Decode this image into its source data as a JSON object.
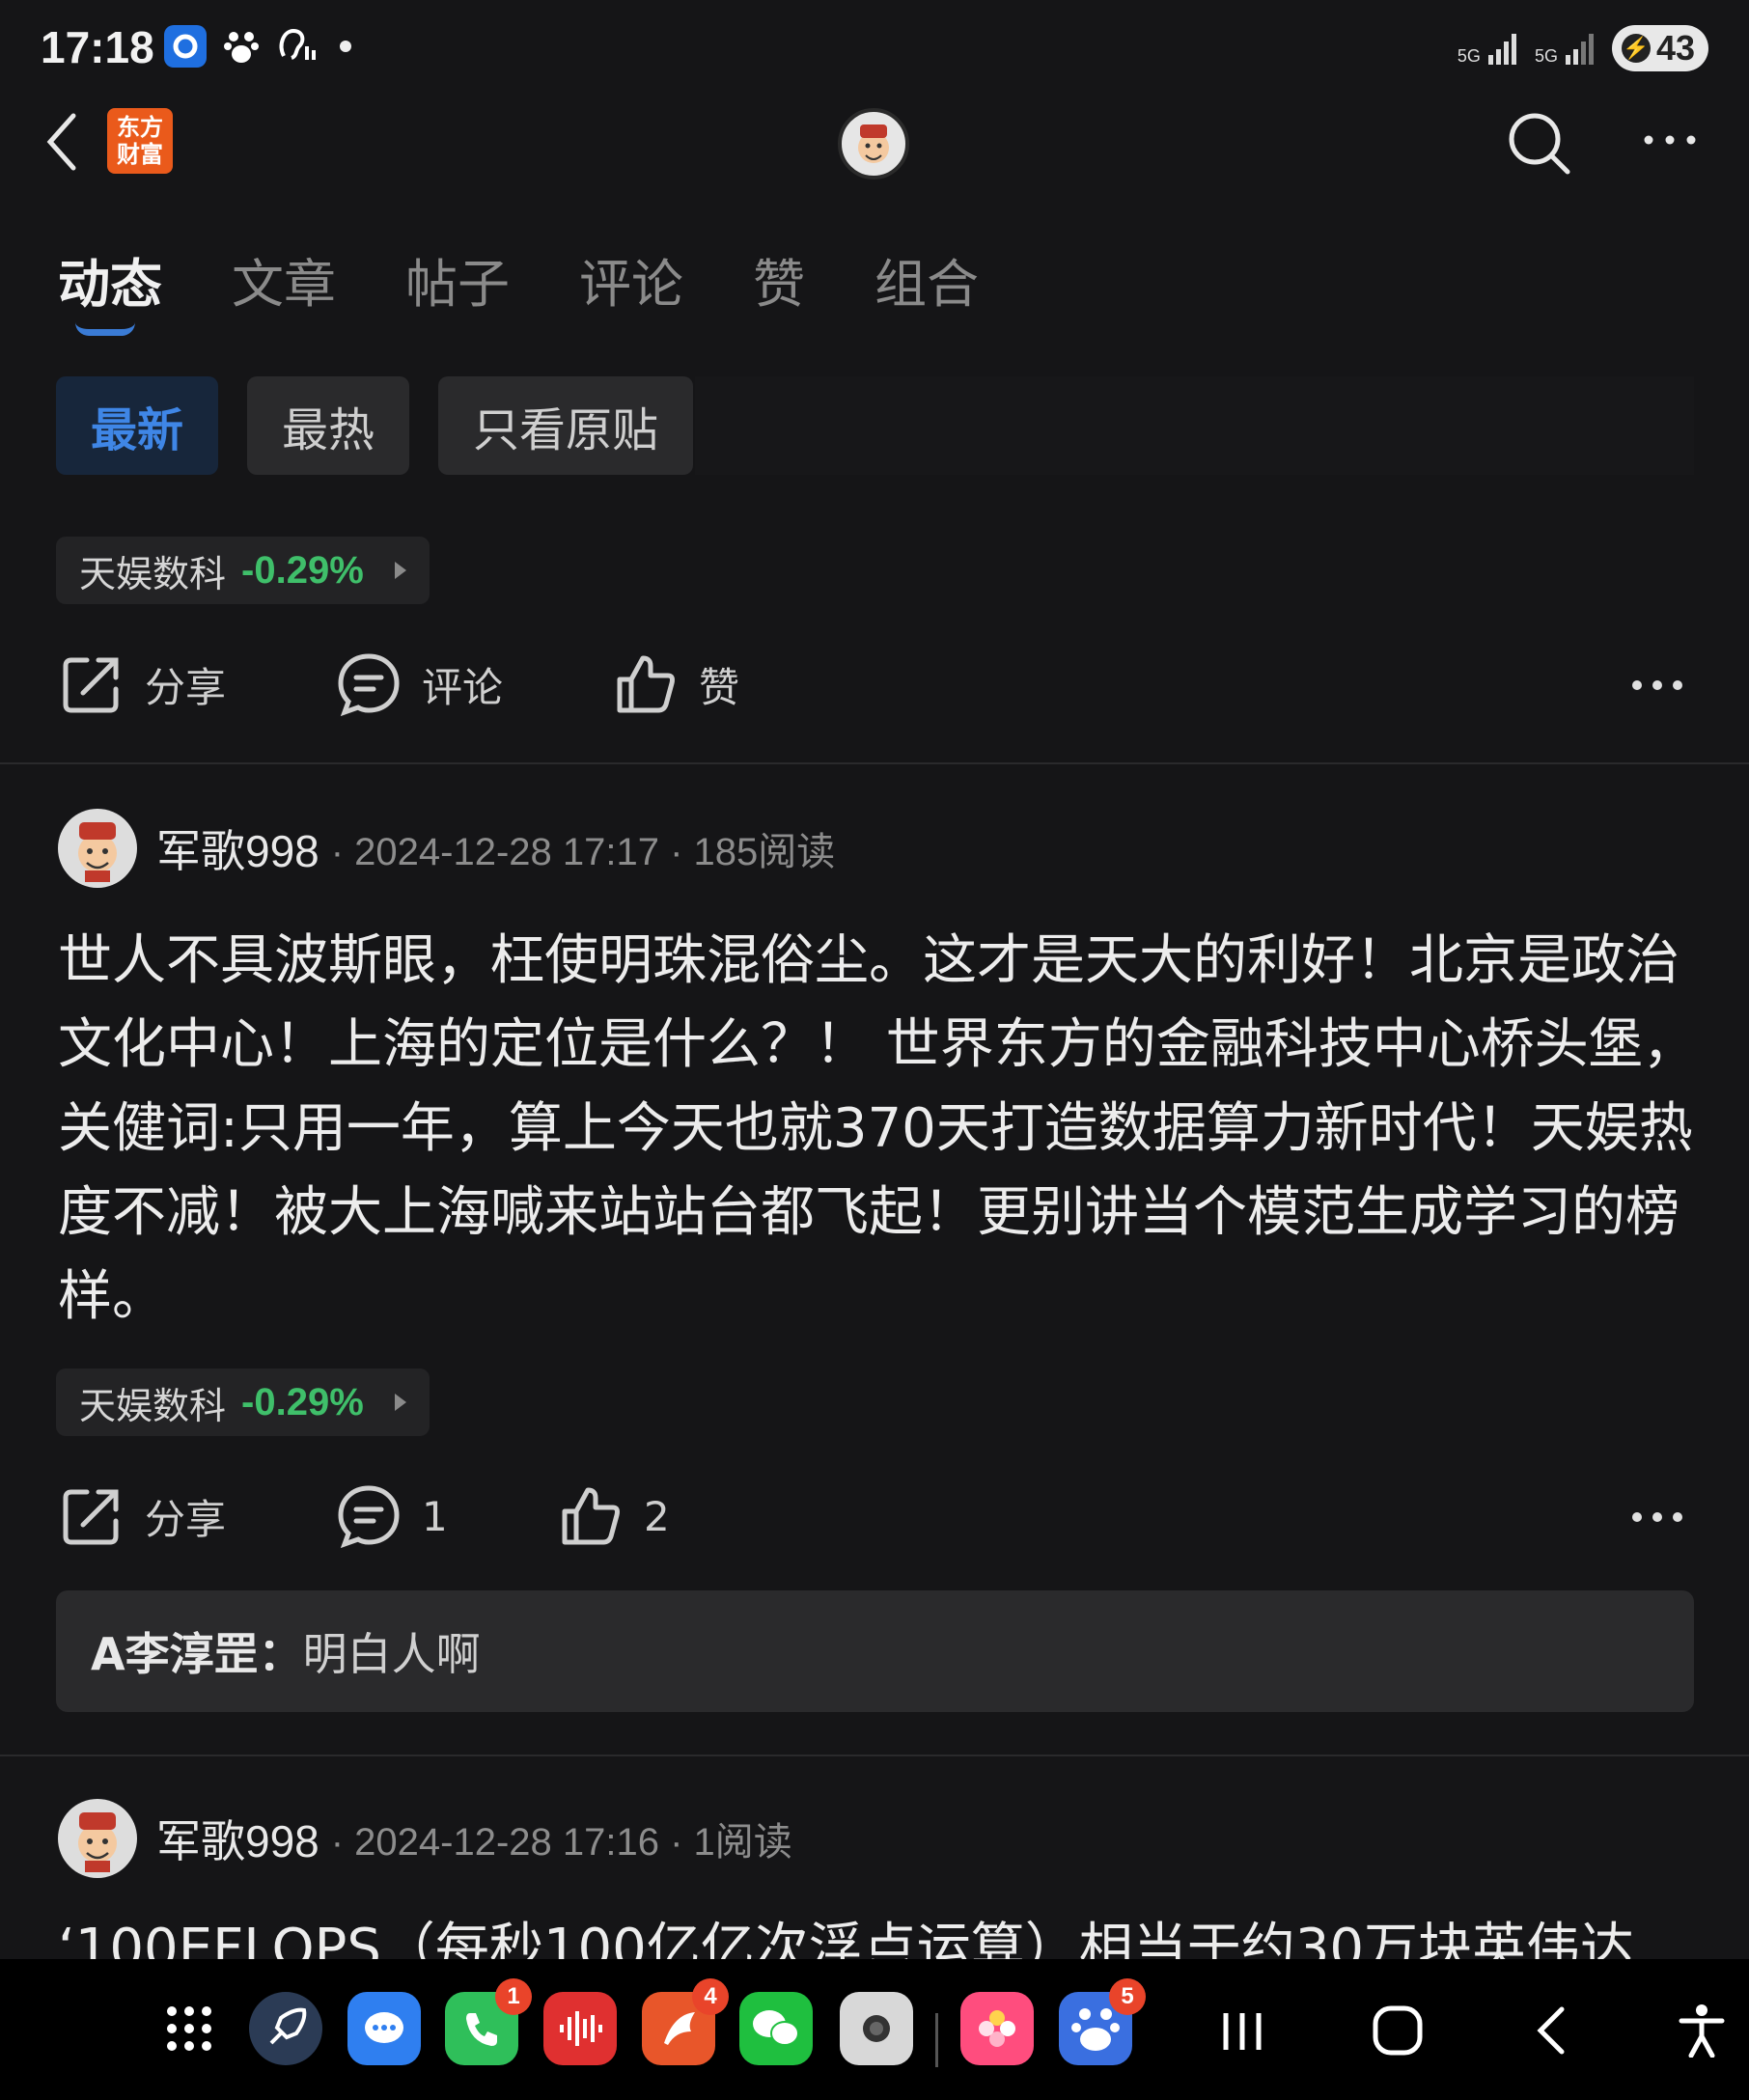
{
  "status_bar": {
    "time": "17:18",
    "net1": "5G",
    "net2": "5G",
    "battery": "43"
  },
  "header": {
    "logo_text": "东方财富",
    "logo_line1": "东方",
    "logo_line2": "财富"
  },
  "tabs": [
    {
      "label": "动态",
      "active": true
    },
    {
      "label": "文章"
    },
    {
      "label": "帖子"
    },
    {
      "label": "评论"
    },
    {
      "label": "赞"
    },
    {
      "label": "组合"
    }
  ],
  "filters": [
    {
      "label": "最新",
      "active": true
    },
    {
      "label": "最热"
    },
    {
      "label": "只看原贴"
    }
  ],
  "top_item": {
    "stock": {
      "name": "天娱数科",
      "change": "-0.29%"
    },
    "actions": {
      "share": "分享",
      "comment": "评论",
      "like": "赞"
    }
  },
  "post1": {
    "author": "军歌998",
    "meta": "· 2024-12-28 17:17 · 185阅读",
    "body": "世人不具波斯眼，枉使明珠混俗尘。这才是天大的利好！北京是政治文化中心！上海的定位是什么？！ 世界东方的金融科技中心桥头堡，关健词:只用一年，算上今天也就370天打造数据算力新时代！天娱热度不减！被大上海喊来站站台都飞起！更别讲当个模范生成学习的榜样。",
    "stock": {
      "name": "天娱数科",
      "change": "-0.29%"
    },
    "actions": {
      "share": "分享",
      "comment_count": "1",
      "like_count": "2"
    },
    "comment": {
      "user": "A李淳罡：",
      "text": "明白人啊"
    }
  },
  "post2": {
    "author": "军歌998",
    "meta": "· 2024-12-28 17:16 · 1阅读",
    "body_preview": "‘100EFLOPS（每秒100亿亿次浮点运算）相当于约30万块英伟达"
  },
  "dock": {
    "badges": {
      "phone": "1",
      "news": "4",
      "baidu": "5"
    }
  },
  "colors": {
    "background": "#151517",
    "accent_blue": "#3f86e6",
    "stock_green": "#3fbf6a",
    "logo_orange": "#ea5a1b"
  }
}
